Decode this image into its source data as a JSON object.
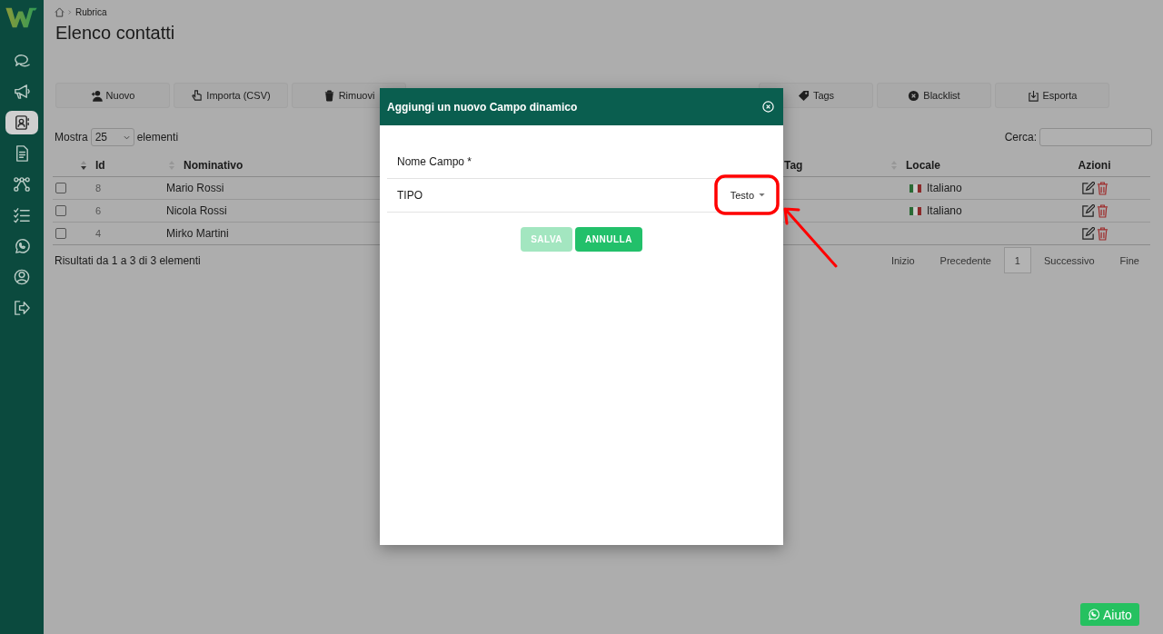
{
  "sidebar": {
    "items": [
      {
        "selected": false
      },
      {
        "selected": false
      },
      {
        "selected": true
      },
      {
        "selected": false
      },
      {
        "selected": false
      },
      {
        "selected": false
      },
      {
        "selected": false
      },
      {
        "selected": false
      },
      {
        "selected": false
      }
    ]
  },
  "breadcrumb": [
    "Rubrica"
  ],
  "title": "Elenco contatti",
  "toolbar_left": [
    {
      "label": "Nuovo"
    },
    {
      "label": "Importa (CSV)"
    },
    {
      "label": "Rimuovi"
    }
  ],
  "toolbar_right": [
    {
      "label": "Tags"
    },
    {
      "label": "Blacklist"
    },
    {
      "label": "Esporta"
    }
  ],
  "length_menu": {
    "label_before": "Mostra",
    "value": "25",
    "label_after": "elementi"
  },
  "search": {
    "label": "Cerca:"
  },
  "table": {
    "columns": [
      {
        "label": "Id",
        "sortable": true,
        "sorted": true
      },
      {
        "label": "Nominativo",
        "sortable": true,
        "sorted": false
      },
      {
        "label": "Tag",
        "sortable": false
      },
      {
        "label": "Locale",
        "sortable": true,
        "sorted": false
      },
      {
        "label": "Azioni",
        "sortable": false
      }
    ],
    "rows": [
      {
        "checked": false,
        "id": "8",
        "name": "Mario Rossi",
        "locale": "Italiano"
      },
      {
        "checked": false,
        "id": "6",
        "name": "Nicola Rossi",
        "locale": "Italiano"
      },
      {
        "checked": false,
        "id": "4",
        "name": "Mirko Martini"
      }
    ]
  },
  "info": "Risultati da 1 a 3 di 3 elementi",
  "pagination": [
    {
      "label": "Inizio",
      "selected": false
    },
    {
      "label": "Precedente",
      "selected": false
    },
    {
      "label": "1",
      "selected": true
    },
    {
      "label": "Successivo",
      "selected": false
    },
    {
      "label": "Fine",
      "selected": false
    }
  ],
  "modal": {
    "title": "Aggiungi un nuovo Campo dinamico",
    "fields": [
      {
        "kind": "text",
        "label": "Nome Campo *"
      },
      {
        "kind": "select",
        "label": "TIPO",
        "value": "Testo"
      }
    ],
    "buttons": [
      {
        "label": "SALVA",
        "disabled": true
      },
      {
        "label": "ANNULLA",
        "disabled": false
      }
    ]
  },
  "help_button": {
    "label": "Aiuto"
  }
}
